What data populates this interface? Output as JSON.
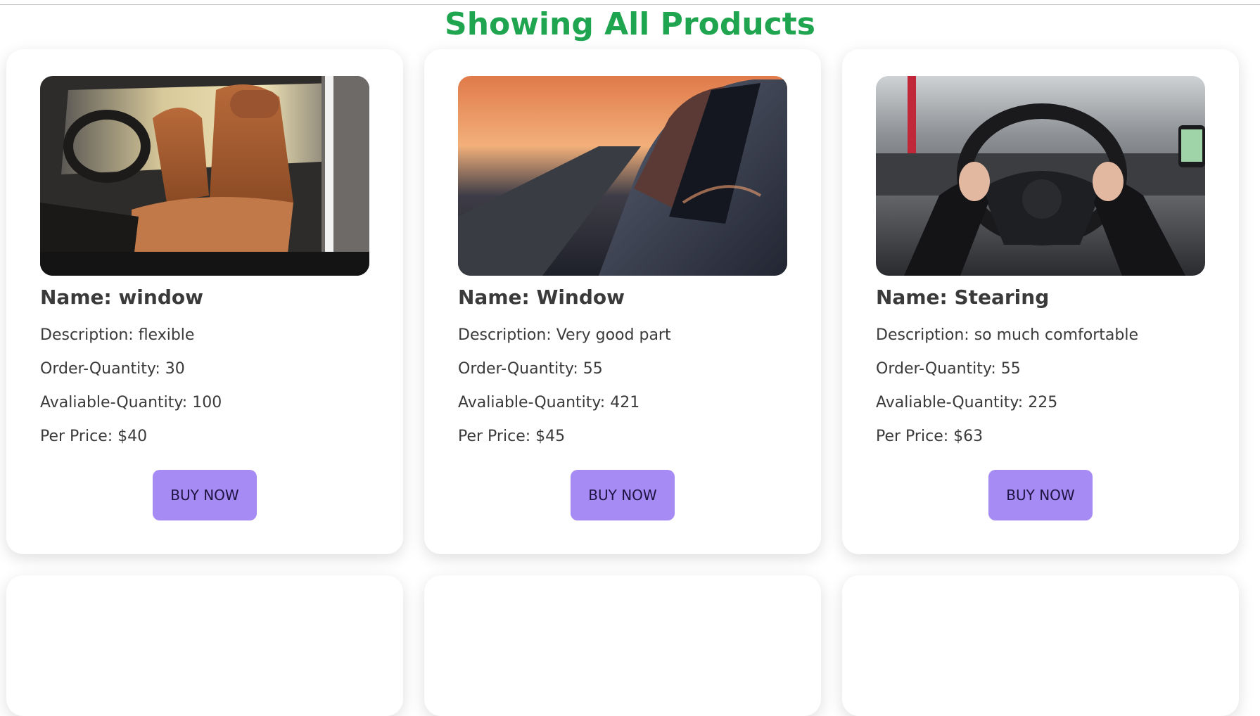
{
  "page": {
    "title": "Showing All Products"
  },
  "labels": {
    "name_prefix": "Name: ",
    "description_prefix": "Description: ",
    "order_prefix": "Order-Quantity: ",
    "available_prefix": "Avaliable-Quantity: ",
    "price_prefix": "Per Price: "
  },
  "products": [
    {
      "name": "Name: window",
      "description": "Description: flexible",
      "order_quantity": "Order-Quantity: 30",
      "available_quantity": "Avaliable-Quantity: 100",
      "per_price": "Per Price: $40",
      "button_label": "BUY NOW",
      "image": "car-seat-interior-image"
    },
    {
      "name": "Name: Window",
      "description": "Description: Very good part",
      "order_quantity": "Order-Quantity: 55",
      "available_quantity": "Avaliable-Quantity: 421",
      "per_price": "Per Price: $45",
      "button_label": "BUY NOW",
      "image": "car-window-sunset-image"
    },
    {
      "name": "Name: Stearing",
      "description": "Description: so much comfortable",
      "order_quantity": "Order-Quantity: 55",
      "available_quantity": "Avaliable-Quantity: 225",
      "per_price": "Per Price: $63",
      "button_label": "BUY NOW",
      "image": "steering-wheel-image"
    }
  ],
  "colors": {
    "title": "#1fa54f",
    "button_bg": "#a78bf4",
    "button_text": "#1d1340",
    "text": "#3a3a3a"
  }
}
